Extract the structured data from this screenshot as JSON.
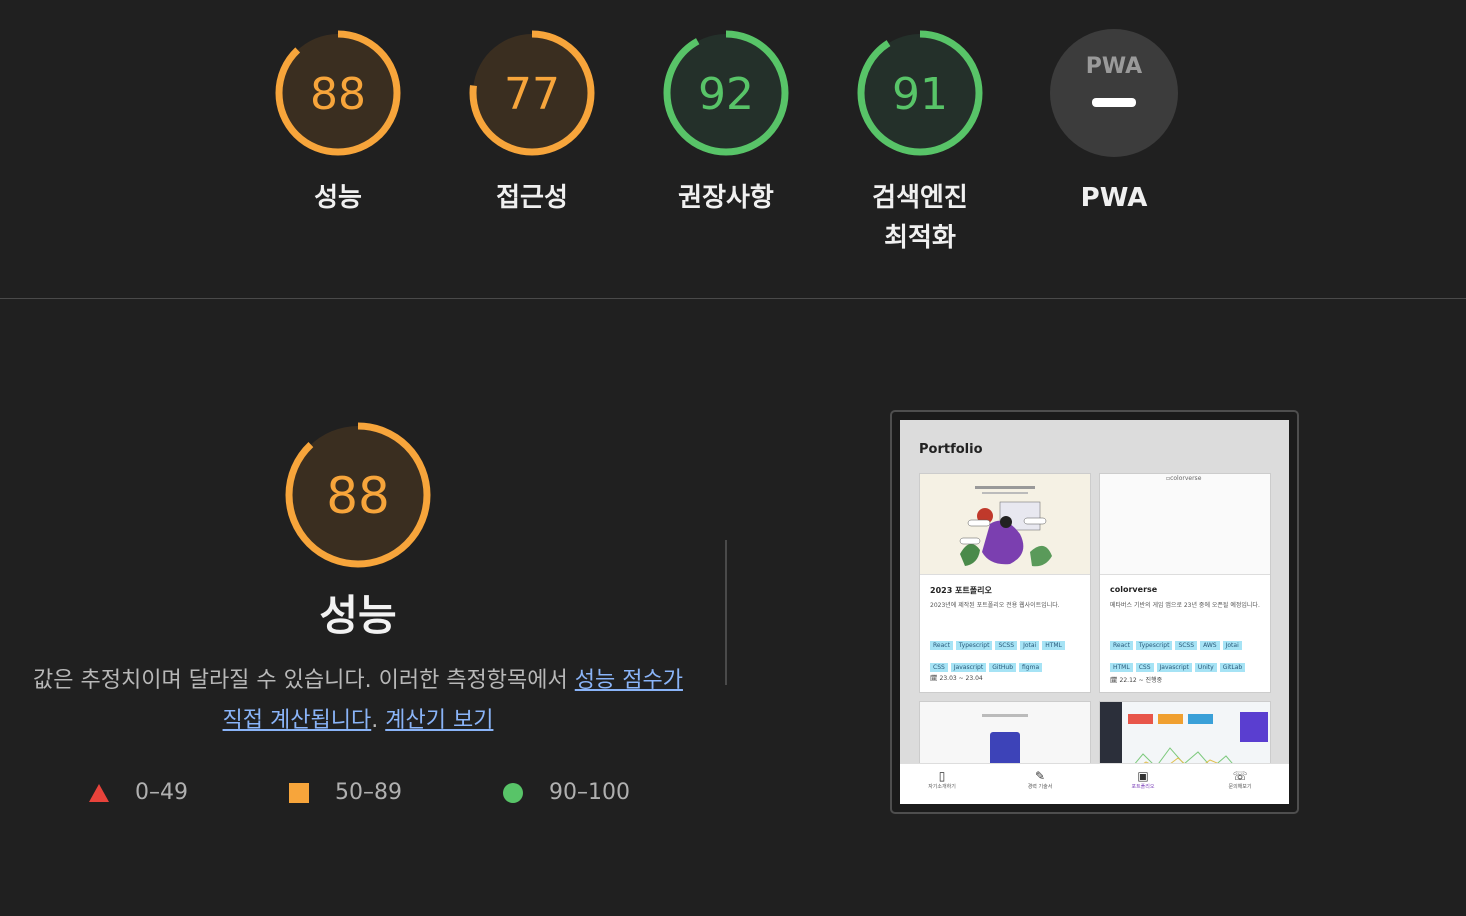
{
  "gauges": [
    {
      "score": "88",
      "label": "성능",
      "label2": "",
      "color": "#f7a53b",
      "fraction": 0.88
    },
    {
      "score": "77",
      "label": "접근성",
      "label2": "",
      "color": "#f7a53b",
      "fraction": 0.77
    },
    {
      "score": "92",
      "label": "권장사항",
      "label2": "",
      "color": "#58c468",
      "fraction": 0.92
    },
    {
      "score": "91",
      "label": "검색엔진",
      "label2": "최적화",
      "color": "#58c468",
      "fraction": 0.91
    }
  ],
  "pwa": {
    "logo": "PWA",
    "label": "PWA"
  },
  "performance": {
    "score": "88",
    "fraction": 0.88,
    "title": "성능",
    "desc_text": "값은 추정치이며 달라질 수 있습니다. 이러한 측정항목에서 ",
    "desc_link": "성능 점수가 직접 계산됩니다",
    "desc_period": ". ",
    "calc_link": "계산기 보기"
  },
  "legend": [
    {
      "shape": "triangle",
      "range": "0–49",
      "color": "#e8433b"
    },
    {
      "shape": "square",
      "range": "50–89",
      "color": "#f7a53b"
    },
    {
      "shape": "circle",
      "range": "90–100",
      "color": "#58c468"
    }
  ],
  "screenshot": {
    "title": "Portfolio",
    "cards": [
      {
        "title": "2023 포트폴리오",
        "desc": "2023년에 제작된 포트폴리오 전용 웹사이트입니다.",
        "tags": [
          "React",
          "Typescript",
          "SCSS",
          "Jotai",
          "HTML",
          "CSS",
          "Javascript",
          "GitHub",
          "figma"
        ],
        "date": "23.03 ~ 23.04",
        "alt": ""
      },
      {
        "title": "colorverse",
        "desc": "메타버스 기반의 게임 앱으로 23년 중에 오픈될 예정입니다.",
        "tags": [
          "React",
          "Typescript",
          "SCSS",
          "AWS",
          "Jotai",
          "HTML",
          "CSS",
          "Javascript",
          "Unity",
          "GitLab"
        ],
        "date": "22.12 ~ 진행중",
        "alt": "colorverse"
      }
    ],
    "nav": [
      {
        "label": "자기소개하기",
        "icon": "▯"
      },
      {
        "label": "경력 기술서",
        "icon": "✎"
      },
      {
        "label": "포트폴리오",
        "icon": "▣"
      },
      {
        "label": "문의해보기",
        "icon": "☏"
      }
    ]
  }
}
